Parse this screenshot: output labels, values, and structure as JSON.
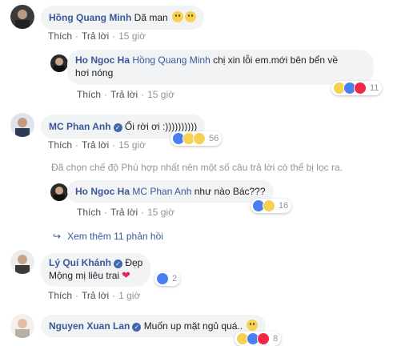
{
  "comments": [
    {
      "author": "Hồng Quang Minh",
      "text": "Dã man",
      "actions": {
        "like": "Thích",
        "reply": "Trả lời",
        "time": "15 giờ"
      }
    },
    {
      "author": "Ho Ngoc Ha",
      "mention": "Hồng Quang Minh",
      "text_line1": "chị xin lỗi em.mới bên bển về",
      "text_line2": "hơi nóng",
      "reactions": {
        "icons": [
          "haha-icon",
          "like-icon",
          "love-icon"
        ],
        "count": "11"
      },
      "actions": {
        "like": "Thích",
        "reply": "Trả lời",
        "time": "15 giờ"
      }
    },
    {
      "author": "MC Phan Anh",
      "text": "Ối rời ơi :))))))))))",
      "reactions": {
        "icons": [
          "like-icon",
          "haha-icon",
          "sad-icon"
        ],
        "count": "56"
      },
      "actions": {
        "like": "Thích",
        "reply": "Trả lời",
        "time": "15 giờ"
      }
    },
    {
      "author": "Ho Ngoc Ha",
      "mention": "MC Phan Anh",
      "text": "như nào Bác???",
      "reactions": {
        "icons": [
          "like-icon",
          "haha-icon"
        ],
        "count": "16"
      },
      "actions": {
        "like": "Thích",
        "reply": "Trả lời",
        "time": "15 giờ"
      }
    },
    {
      "author": "Lý Quí Khánh",
      "text_line1": "Đẹp",
      "text_line2": "Mộng mị liêu trai",
      "reactions": {
        "icons": [
          "like-icon"
        ],
        "count": "2"
      },
      "actions": {
        "like": "Thích",
        "reply": "Trả lời",
        "time": "1 giờ"
      }
    },
    {
      "author": "Nguyen Xuan Lan",
      "text": "Muốn up mặt ngủ quá..",
      "reactions": {
        "icons": [
          "haha-icon",
          "like-icon",
          "love-icon"
        ],
        "count": "8"
      }
    }
  ],
  "filter_note": "Đã chọn chế độ Phù hợp nhất nên một số câu trả lời có thể bị lọc ra.",
  "more_replies": "Xem thêm 11 phản hồi",
  "colors": {
    "link": "#385898",
    "bubble": "#f2f3f5",
    "like": "#4a7ff0",
    "love": "#f0284a",
    "haha": "#f7d154"
  }
}
